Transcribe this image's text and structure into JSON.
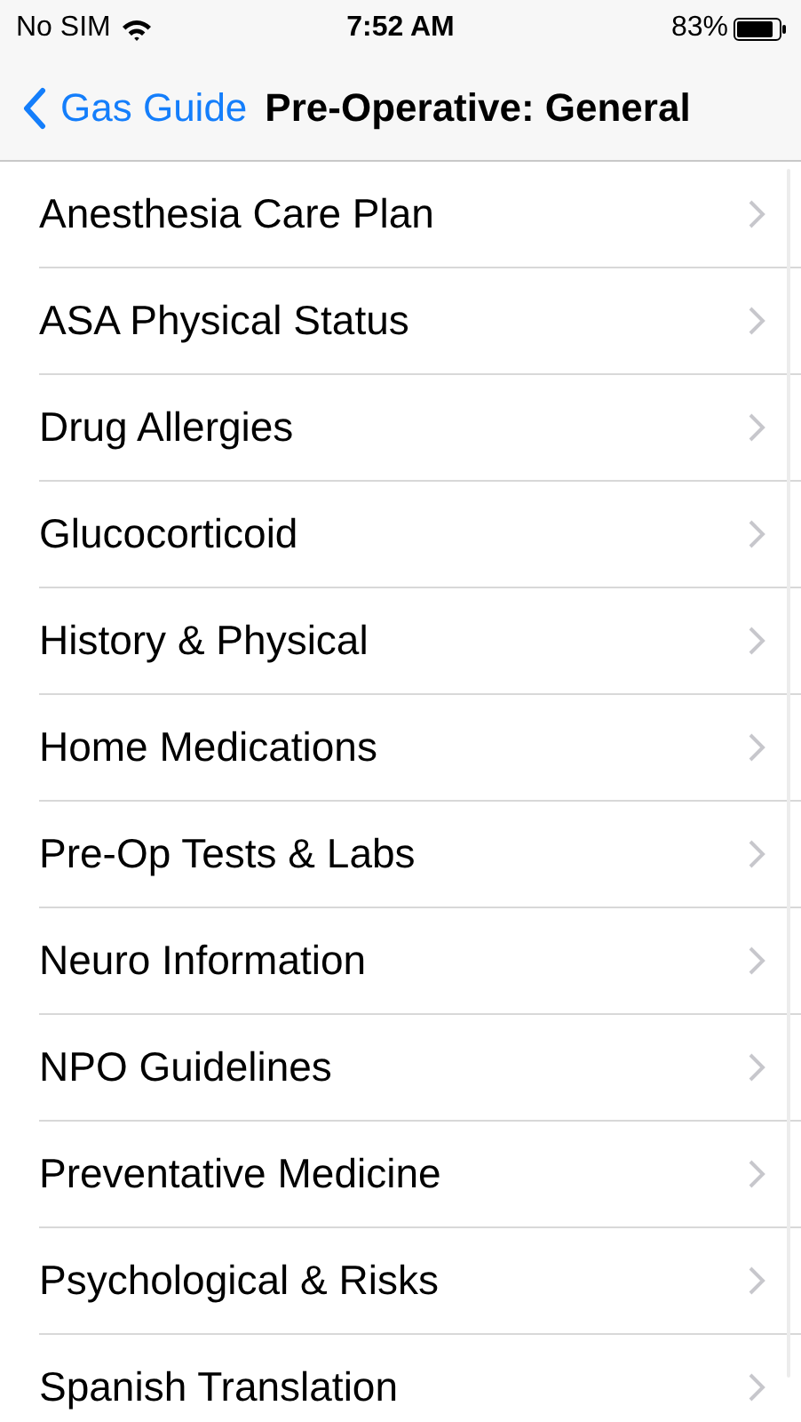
{
  "status_bar": {
    "carrier": "No SIM",
    "time": "7:52 AM",
    "battery": "83%"
  },
  "nav_bar": {
    "back": "Gas Guide",
    "title": "Pre-Operative: General"
  },
  "items": [
    {
      "label": "Anesthesia Care Plan"
    },
    {
      "label": "ASA Physical Status"
    },
    {
      "label": "Drug Allergies"
    },
    {
      "label": "Glucocorticoid"
    },
    {
      "label": "History & Physical"
    },
    {
      "label": "Home Medications"
    },
    {
      "label": "Pre-Op Tests & Labs"
    },
    {
      "label": "Neuro Information"
    },
    {
      "label": "NPO Guidelines"
    },
    {
      "label": "Preventative Medicine"
    },
    {
      "label": "Psychological & Risks"
    },
    {
      "label": "Spanish Translation"
    }
  ]
}
